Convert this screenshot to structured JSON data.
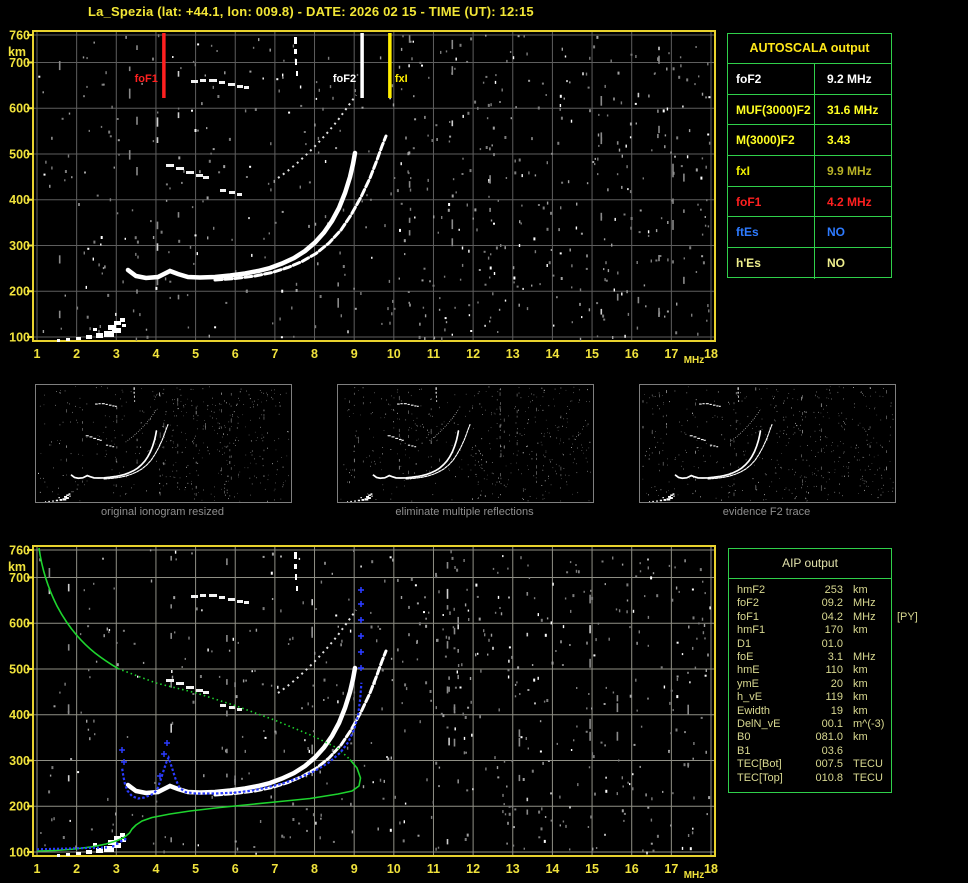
{
  "title": "La_Spezia (lat: +44.1, lon: 009.8) - DATE: 2026 02 15 - TIME (UT): 12:15",
  "colors": {
    "axis_yellow": "#f0e23c",
    "border_yellow": "#e8d22e",
    "grid_top": "#5e5e5e",
    "grid_bottom": "#8f8f85",
    "table_green": "#2fd04a",
    "trace_white": "#ffffff",
    "profile_green": "#1ed42e",
    "trace_blue": "#2a3bff",
    "caption_gray": "#8f8f8f"
  },
  "plot_axes": {
    "y_ticks": [
      {
        "label": "760",
        "km": 760
      },
      {
        "label": "700",
        "km": 700
      },
      {
        "label": "600",
        "km": 600
      },
      {
        "label": "500",
        "km": 500
      },
      {
        "label": "400",
        "km": 400
      },
      {
        "label": "300",
        "km": 300
      },
      {
        "label": "200",
        "km": 200
      },
      {
        "label": "100",
        "km": 100
      }
    ],
    "y_unit": "km",
    "x_ticks": [
      "1",
      "2",
      "3",
      "4",
      "5",
      "6",
      "7",
      "8",
      "9",
      "10",
      "11",
      "12",
      "13",
      "14",
      "15",
      "16",
      "17",
      "18"
    ],
    "x_unit": "MHz"
  },
  "top_plot_markers": [
    {
      "id": "foF1",
      "label": "foF1",
      "mhz": 4.2,
      "color": "#ff2020"
    },
    {
      "id": "foF2",
      "label": "foF2",
      "mhz": 9.2,
      "color": "#ffffff"
    },
    {
      "id": "fxI",
      "label": "fxI",
      "mhz": 9.9,
      "color": "#ffee00"
    }
  ],
  "autoscala": {
    "header": "AUTOSCALA output",
    "rows": [
      {
        "id": "foF2",
        "label": "foF2",
        "value": "9.2 MHz",
        "label_color": "#ffffff",
        "value_color": "#ffffff"
      },
      {
        "id": "MUF3000F2",
        "label": "MUF(3000)F2",
        "value": "31.6 MHz",
        "label_color": "#ffff22",
        "value_color": "#ffff22"
      },
      {
        "id": "M3000F2",
        "label": "M(3000)F2",
        "value": "3.43",
        "label_color": "#ffff22",
        "value_color": "#ffff22"
      },
      {
        "id": "fxI",
        "label": "fxI",
        "value": "9.9 MHz",
        "label_color": "#f0f000",
        "value_color": "#b9b326"
      },
      {
        "id": "foF1",
        "label": "foF1",
        "value": "4.2 MHz",
        "label_color": "#ff2020",
        "value_color": "#ff2020"
      },
      {
        "id": "ftEs",
        "label": "ftEs",
        "value": "NO",
        "label_color": "#2e7bff",
        "value_color": "#2e7bff"
      },
      {
        "id": "hEs",
        "label": "h'Es",
        "value": "NO",
        "label_color": "#efef8d",
        "value_color": "#efef8d"
      }
    ]
  },
  "thumbnails": [
    {
      "caption": "original ionogram resized"
    },
    {
      "caption": "eliminate multiple reflections"
    },
    {
      "caption": "evidence F2 trace"
    }
  ],
  "aip": {
    "header": "AIP output",
    "rows": [
      {
        "label": "hmF2",
        "value": "253",
        "unit": "km",
        "extra": ""
      },
      {
        "label": "foF2",
        "value": "09.2",
        "unit": "MHz",
        "extra": ""
      },
      {
        "label": "foF1",
        "value": "04.2",
        "unit": "MHz",
        "extra": "[PY]"
      },
      {
        "label": "hmF1",
        "value": "170",
        "unit": "km",
        "extra": ""
      },
      {
        "label": "D1",
        "value": "01.0",
        "unit": "",
        "extra": ""
      },
      {
        "label": "foE",
        "value": "3.1",
        "unit": "MHz",
        "extra": ""
      },
      {
        "label": "hmE",
        "value": "110",
        "unit": "km",
        "extra": ""
      },
      {
        "label": "ymE",
        "value": "20",
        "unit": "km",
        "extra": ""
      },
      {
        "label": "h_vE",
        "value": "119",
        "unit": "km",
        "extra": ""
      },
      {
        "label": "Ewidth",
        "value": "19",
        "unit": "km",
        "extra": ""
      },
      {
        "label": "DelN_vE",
        "value": "00.1",
        "unit": "m^(-3)",
        "extra": ""
      },
      {
        "label": "B0",
        "value": "081.0",
        "unit": "km",
        "extra": ""
      },
      {
        "label": "B1",
        "value": "03.6",
        "unit": "",
        "extra": ""
      },
      {
        "label": "TEC[Bot]",
        "value": "007.5",
        "unit": "TECU",
        "extra": ""
      },
      {
        "label": "TEC[Top]",
        "value": "010.8",
        "unit": "TECU",
        "extra": ""
      }
    ]
  }
}
